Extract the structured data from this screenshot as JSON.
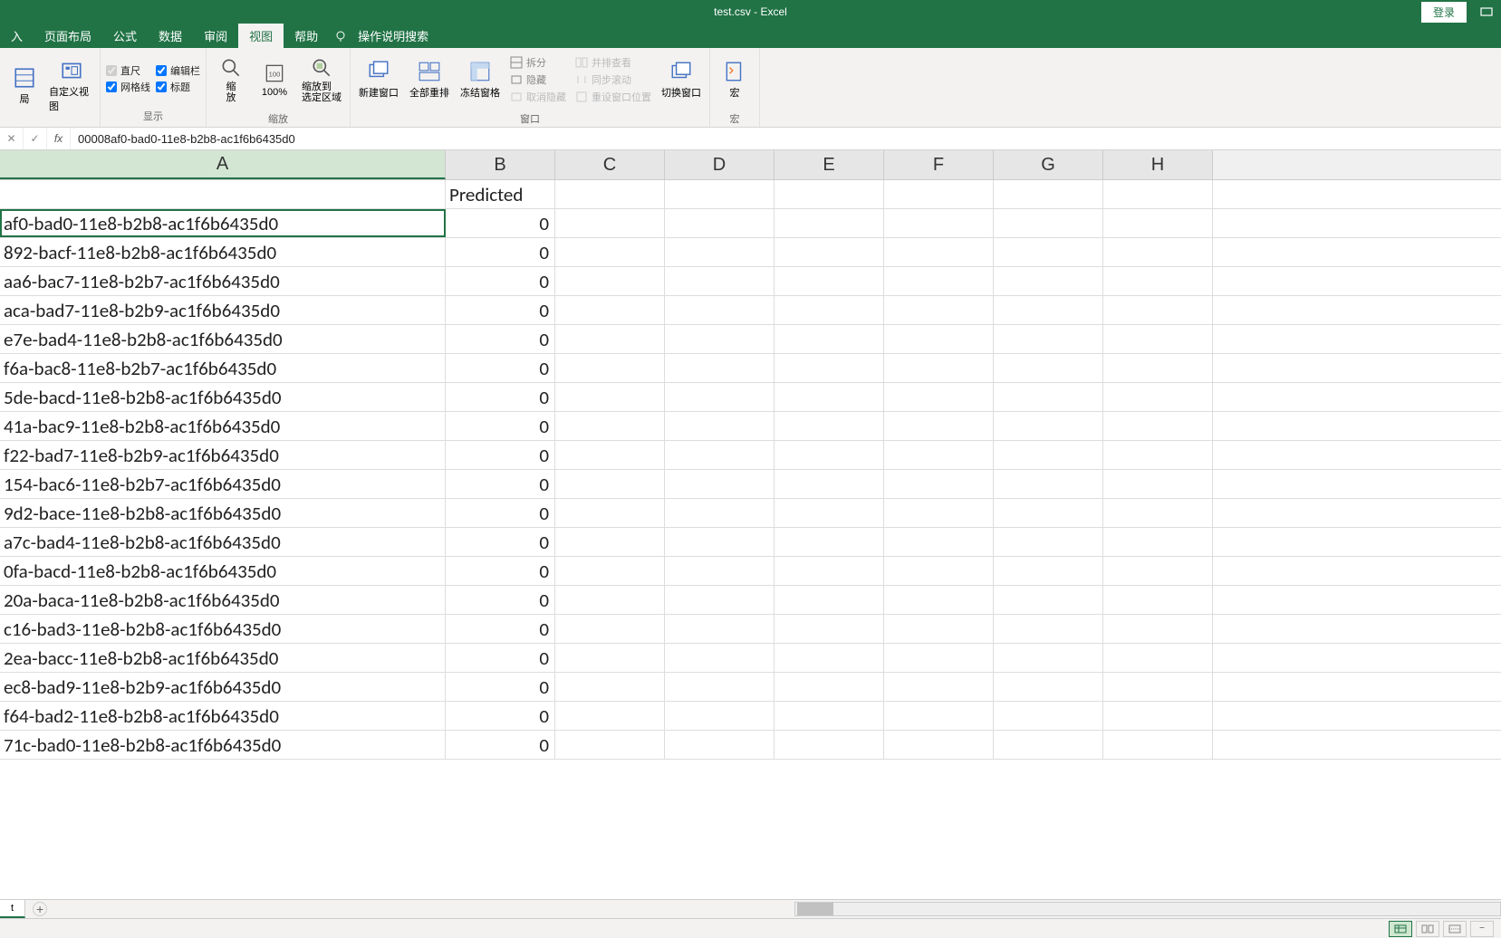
{
  "title": {
    "filename": "test.csv",
    "separator": "  -  ",
    "app": "Excel",
    "login": "登录"
  },
  "tabs": {
    "insert": "入",
    "page_layout": "页面布局",
    "formulas": "公式",
    "data": "数据",
    "review": "审阅",
    "view": "视图",
    "help": "帮助",
    "search": "操作说明搜索"
  },
  "ribbon": {
    "views": {
      "layout": "局",
      "custom": "自定义视图",
      "label": ""
    },
    "show": {
      "ruler": "直尺",
      "formula_bar": "编辑栏",
      "gridlines": "网格线",
      "headings": "标题",
      "label": "显示"
    },
    "zoom": {
      "zoom": "缩\n放",
      "hundred": "100%",
      "to_selection": "缩放到\n选定区域",
      "label": "缩放"
    },
    "window": {
      "new_window": "新建窗口",
      "arrange_all": "全部重排",
      "freeze": "冻结窗格",
      "split": "拆分",
      "hide": "隐藏",
      "unhide": "取消隐藏",
      "side_by_side": "并排查看",
      "sync_scroll": "同步滚动",
      "reset_pos": "重设窗口位置",
      "switch": "切换窗口",
      "label": "窗口"
    },
    "macros": {
      "macros": "宏",
      "label": "宏"
    }
  },
  "formula_bar": {
    "value": "00008af0-bad0-11e8-b2b8-ac1f6b6435d0"
  },
  "columns": [
    "A",
    "B",
    "C",
    "D",
    "E",
    "F",
    "G",
    "H"
  ],
  "headers": {
    "B": "Predicted"
  },
  "rows": [
    {
      "a": "af0-bad0-11e8-b2b8-ac1f6b6435d0",
      "b": "0"
    },
    {
      "a": "892-bacf-11e8-b2b8-ac1f6b6435d0",
      "b": "0"
    },
    {
      "a": "aa6-bac7-11e8-b2b7-ac1f6b6435d0",
      "b": "0"
    },
    {
      "a": "aca-bad7-11e8-b2b9-ac1f6b6435d0",
      "b": "0"
    },
    {
      "a": "e7e-bad4-11e8-b2b8-ac1f6b6435d0",
      "b": "0"
    },
    {
      "a": "f6a-bac8-11e8-b2b7-ac1f6b6435d0",
      "b": "0"
    },
    {
      "a": "5de-bacd-11e8-b2b8-ac1f6b6435d0",
      "b": "0"
    },
    {
      "a": "41a-bac9-11e8-b2b8-ac1f6b6435d0",
      "b": "0"
    },
    {
      "a": "f22-bad7-11e8-b2b9-ac1f6b6435d0",
      "b": "0"
    },
    {
      "a": "154-bac6-11e8-b2b7-ac1f6b6435d0",
      "b": "0"
    },
    {
      "a": "9d2-bace-11e8-b2b8-ac1f6b6435d0",
      "b": "0"
    },
    {
      "a": "a7c-bad4-11e8-b2b8-ac1f6b6435d0",
      "b": "0"
    },
    {
      "a": "0fa-bacd-11e8-b2b8-ac1f6b6435d0",
      "b": "0"
    },
    {
      "a": "20a-baca-11e8-b2b8-ac1f6b6435d0",
      "b": "0"
    },
    {
      "a": "c16-bad3-11e8-b2b8-ac1f6b6435d0",
      "b": "0"
    },
    {
      "a": "2ea-bacc-11e8-b2b8-ac1f6b6435d0",
      "b": "0"
    },
    {
      "a": "ec8-bad9-11e8-b2b9-ac1f6b6435d0",
      "b": "0"
    },
    {
      "a": "f64-bad2-11e8-b2b8-ac1f6b6435d0",
      "b": "0"
    },
    {
      "a": "71c-bad0-11e8-b2b8-ac1f6b6435d0",
      "b": "0"
    }
  ],
  "sheet": {
    "name": "t"
  }
}
